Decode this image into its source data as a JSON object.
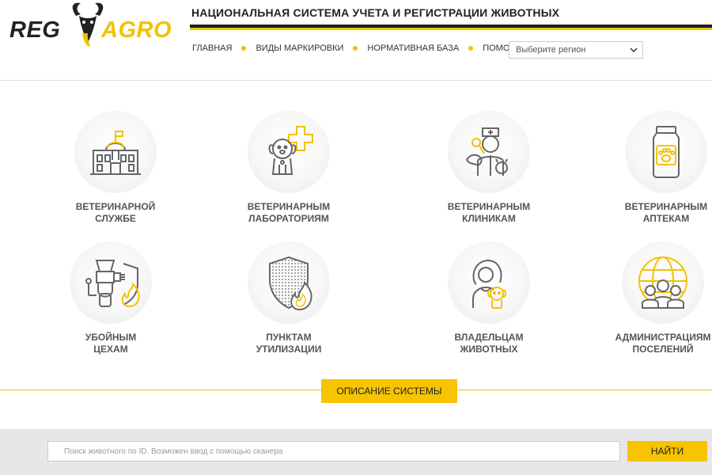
{
  "logo": {
    "left_text": "REG",
    "right_text": "AGRO"
  },
  "header": {
    "title": "НАЦИОНАЛЬНАЯ СИСТЕМА УЧЕТА И РЕГИСТРАЦИИ ЖИВОТНЫХ"
  },
  "nav": {
    "items": [
      {
        "label": "ГЛАВНАЯ"
      },
      {
        "label": "ВИДЫ МАРКИРОВКИ"
      },
      {
        "label": "НОРМАТИВНАЯ БАЗА"
      },
      {
        "label": "ПОМОЩЬ"
      }
    ]
  },
  "region": {
    "selected": "Выберите регион"
  },
  "categories": [
    {
      "line1": "ВЕТЕРИНАРНОЙ",
      "line2": "СЛУЖБЕ",
      "icon": "building-icon"
    },
    {
      "line1": "ВЕТЕРИНАРНЫМ",
      "line2": "ЛАБОРАТОРИЯМ",
      "icon": "dog-cross-icon"
    },
    {
      "line1": "ВЕТЕРИНАРНЫМ",
      "line2": "КЛИНИКАМ",
      "icon": "vet-doctor-icon"
    },
    {
      "line1": "ВЕТЕРИНАРНЫМ",
      "line2": "АПТЕКАМ",
      "icon": "pharmacy-jar-icon"
    },
    {
      "line1": "УБОЙНЫМ",
      "line2": "ЦЕХАМ",
      "icon": "meat-grinder-icon"
    },
    {
      "line1": "ПУНКТАМ",
      "line2": "УТИЛИЗАЦИИ",
      "icon": "shield-fire-icon"
    },
    {
      "line1": "ВЛАДЕЛЬЦАМ",
      "line2": "ЖИВОТНЫХ",
      "icon": "owner-dog-icon"
    },
    {
      "line1": "АДМИНИСТРАЦИЯМ",
      "line2": "ПОСЕЛЕНИЙ",
      "icon": "globe-people-icon"
    }
  ],
  "description_button": "ОПИСАНИЕ СИСТЕМЫ",
  "search": {
    "placeholder": "Поиск животного по ID. Возможен ввод с помощью сканера",
    "button": "НАЙТИ"
  },
  "colors": {
    "accent": "#f2c200",
    "dark": "#1e1e1e",
    "icon_gray": "#666666"
  }
}
